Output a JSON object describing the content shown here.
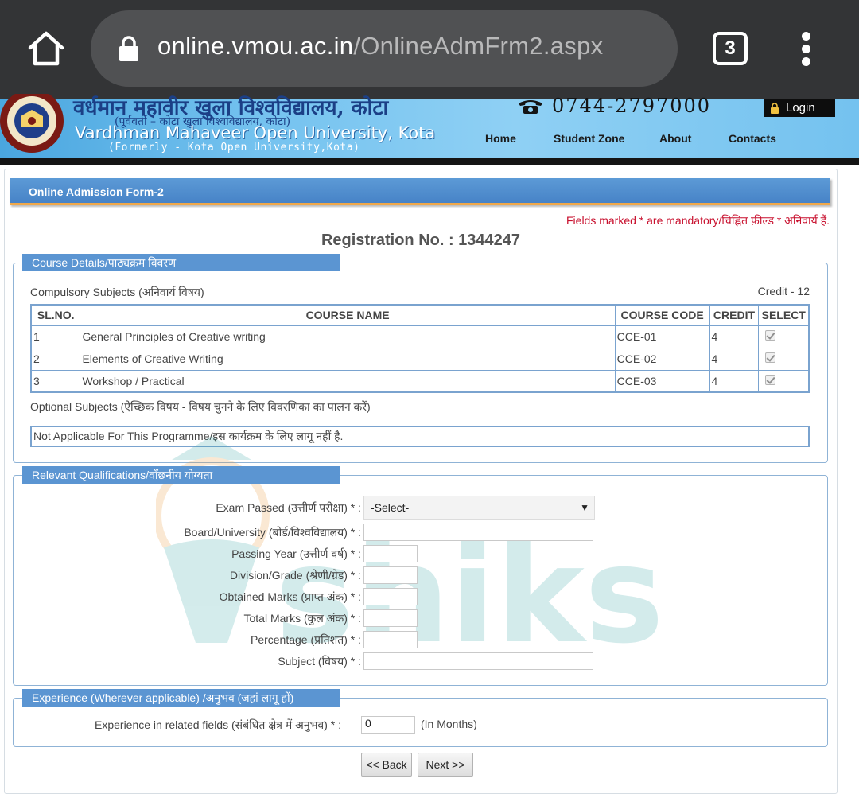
{
  "browser": {
    "url_host": "online.vmou.ac.in",
    "url_path": "/OnlineAdmFrm2.aspx",
    "tab_count": "3"
  },
  "header": {
    "univ_name_hindi": "वर्धमान महावीर खुला विश्वविद्यालय, कोटा",
    "univ_former_hindi": "(पूर्ववर्ती – कोटा खुला विश्वविद्यालय, कोटा)",
    "univ_name_english": "Vardhman Mahaveer Open University, Kota",
    "univ_former_english": "(Formerly - Kota Open University,Kota)",
    "phone": "0744-2797000",
    "login_label": "Login",
    "nav": [
      "Home",
      "Student Zone",
      "About",
      "Contacts"
    ]
  },
  "form": {
    "title": "Online Admission Form-2",
    "mandatory_note": "Fields marked * are mandatory/चिह्नित फ़ील्ड * अनिवार्य हैं.",
    "registration": "Registration No. : 1344247"
  },
  "course_details": {
    "legend": "Course Details/पाठ्यक्रम विवरण",
    "compulsory_label": "Compulsory Subjects (अनिवार्य विषय)",
    "credit_label": "Credit - 12",
    "columns": [
      "SL.NO.",
      "COURSE NAME",
      "COURSE CODE",
      "CREDIT",
      "SELECT"
    ],
    "rows": [
      {
        "sl": "1",
        "name": "General Principles of Creative writing",
        "code": "CCE-01",
        "credit": "4",
        "selected": true
      },
      {
        "sl": "2",
        "name": "Elements of Creative Writing",
        "code": "CCE-02",
        "credit": "4",
        "selected": true
      },
      {
        "sl": "3",
        "name": "Workshop / Practical",
        "code": "CCE-03",
        "credit": "4",
        "selected": true
      }
    ],
    "optional_label": "Optional Subjects (ऐच्छिक विषय - विषय चुनने के लिए विवरणिका का पालन करें)",
    "optional_value": "Not Applicable For This Programme/इस कार्यक्रम के लिए लागू नहीं है."
  },
  "qualifications": {
    "legend": "Relevant Qualifications/वाँछनीय योग्यता",
    "exam_passed_label": "Exam Passed (उत्तीर्ण परीक्षा) * :",
    "exam_passed_value": "-Select-",
    "board_label": "Board/University (बोर्ड/विश्वविद्यालय) * :",
    "passing_year_label": "Passing Year (उत्तीर्ण वर्ष) * :",
    "division_label": "Division/Grade (श्रेणी/ग्रेड) * :",
    "obtained_label": "Obtained Marks (प्राप्त अंक) * :",
    "total_label": "Total Marks (कुल अंक) * :",
    "percentage_label": "Percentage (प्रतिशत) * :",
    "subject_label": "Subject (विषय) * :"
  },
  "experience": {
    "legend": "Experience (Wherever applicable) /अनुभव (जहां लागू हों)",
    "label": "Experience in related fields (संबंधित क्षेत्र में अनुभव) * :",
    "value": "0",
    "unit": "(In Months)"
  },
  "buttons": {
    "back": "<< Back",
    "next": "Next >>"
  },
  "watermark": {
    "text": "shiksha"
  },
  "colors": {
    "chrome_bg": "#333436",
    "title_bar": "#5b95d2",
    "accent_orange": "#f0a84a",
    "mandatory_red": "#c8102e"
  }
}
